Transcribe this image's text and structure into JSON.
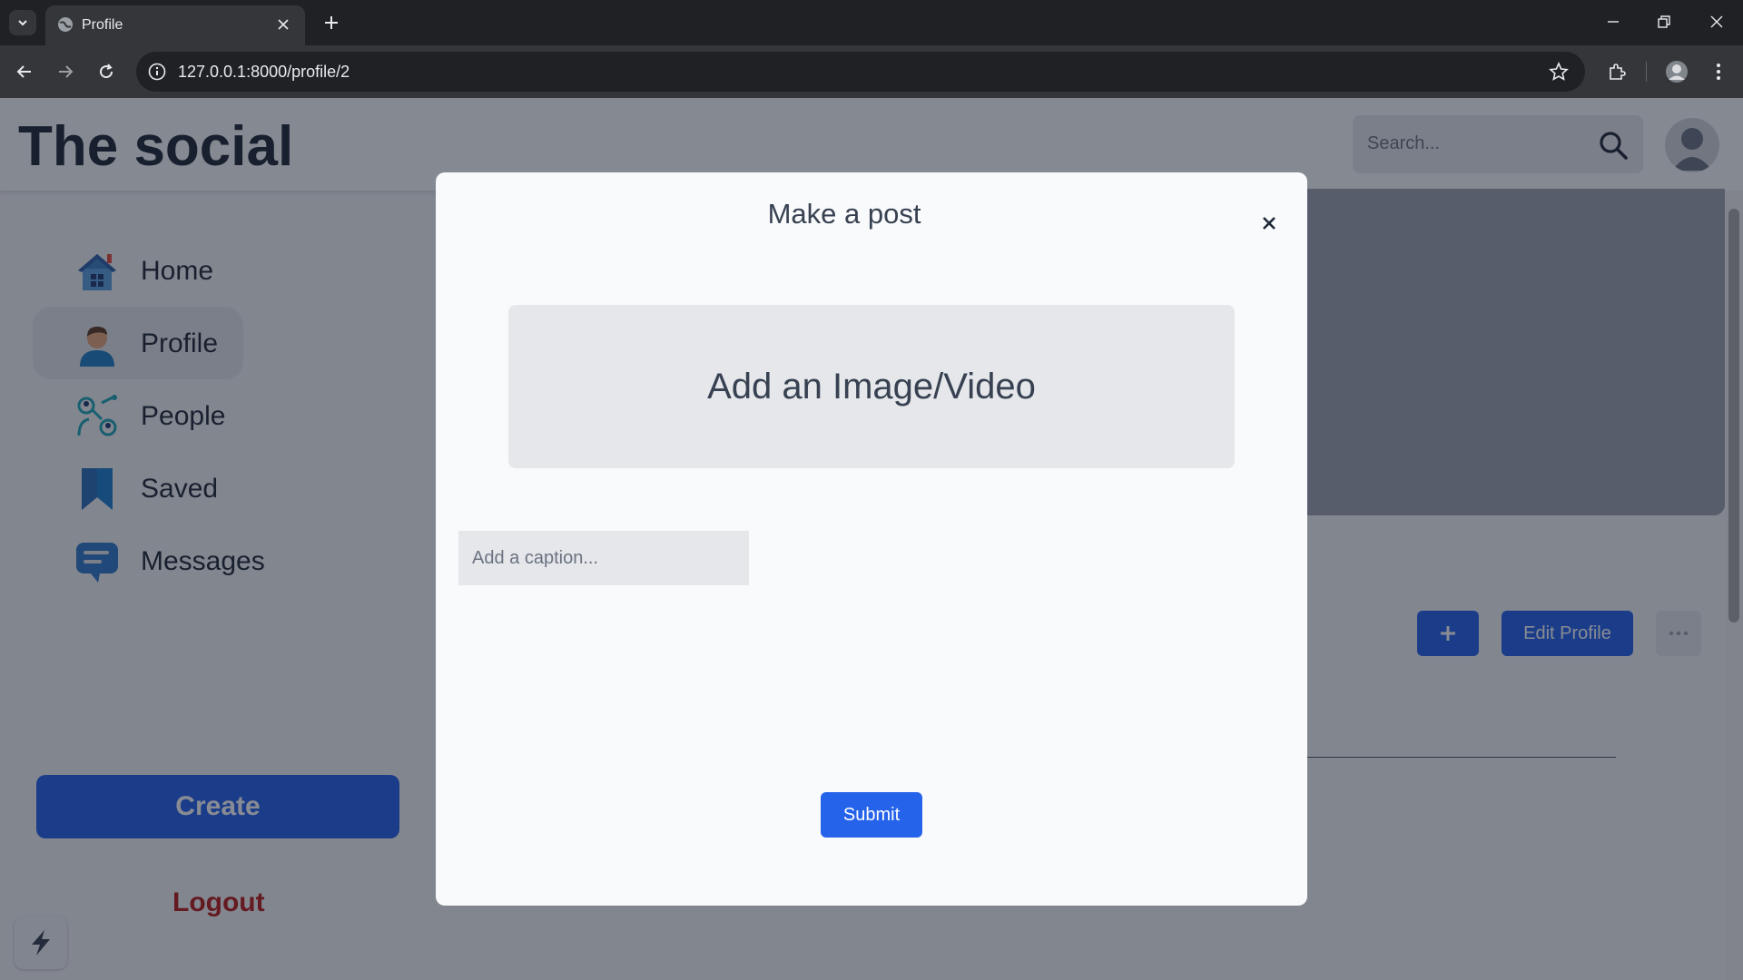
{
  "browser": {
    "tab_title": "Profile",
    "url": "127.0.0.1:8000/profile/2"
  },
  "header": {
    "logo": "The social",
    "search_placeholder": "Search..."
  },
  "sidebar": {
    "items": [
      {
        "label": "Home",
        "icon": "home-icon"
      },
      {
        "label": "Profile",
        "icon": "profile-person-icon"
      },
      {
        "label": "People",
        "icon": "people-network-icon"
      },
      {
        "label": "Saved",
        "icon": "bookmark-icon"
      },
      {
        "label": "Messages",
        "icon": "chat-bubble-icon"
      }
    ],
    "create_label": "Create",
    "logout_label": "Logout"
  },
  "profile": {
    "add_button_icon": "plus-icon",
    "edit_label": "Edit Profile",
    "more_icon": "ellipsis-icon"
  },
  "modal": {
    "title": "Make a post",
    "upload_label": "Add an Image/Video",
    "caption_placeholder": "Add a caption...",
    "caption_value": "",
    "submit_label": "Submit"
  },
  "colors": {
    "accent": "#2563eb",
    "logout": "#b91c1c",
    "overlay": "rgba(17,24,39,0.5)"
  }
}
